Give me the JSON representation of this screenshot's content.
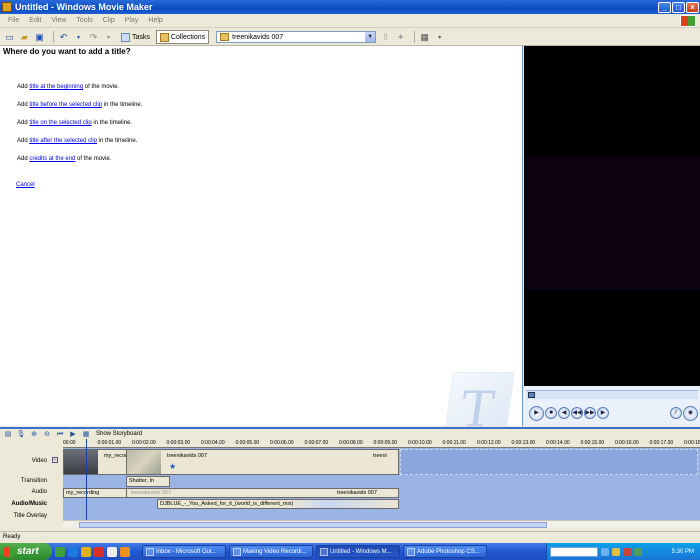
{
  "window": {
    "title": "Untitled - Windows Movie Maker"
  },
  "menu": [
    "File",
    "Edit",
    "View",
    "Tools",
    "Clip",
    "Play",
    "Help"
  ],
  "toolbar": {
    "tasks_label": "Tasks",
    "collections_label": "Collections",
    "collection_value": "treenikavids 007"
  },
  "taskpane": {
    "heading": "Where do you want to add a title?",
    "options": [
      {
        "prefix": "Add ",
        "link": "title at the beginning",
        "suffix": " of the movie."
      },
      {
        "prefix": "Add ",
        "link": "title before the selected clip",
        "suffix": " in the timeline."
      },
      {
        "prefix": "Add ",
        "link": "title on the selected clip",
        "suffix": " in the timeline."
      },
      {
        "prefix": "Add ",
        "link": "title after the selected clip",
        "suffix": " in the timeline."
      },
      {
        "prefix": "Add ",
        "link": "credits at the end",
        "suffix": " of the movie."
      }
    ],
    "cancel": "Cancel",
    "watermark_letter": "T"
  },
  "timeline": {
    "toolbar_label": "Show Storyboard",
    "ruler": [
      "00:00",
      "0:00:01.00",
      "0:00:02.00",
      "0:00:03.00",
      "0:00:04.00",
      "0:00:05.00",
      "0:00:06.00",
      "0:00:07.00",
      "0:00:08.00",
      "0:00:09.00",
      "0:00:10.00",
      "0:00:11.00",
      "0:00:12.00",
      "0:00:13.00",
      "0:00:14.00",
      "0:00:15.00",
      "0:00:16.00",
      "0:00:17.00",
      "0:00:18"
    ],
    "track_names": [
      "Video",
      "Transition",
      "Audio",
      "Audio/Music",
      "Title Overlay"
    ],
    "video_expand": "−",
    "video_clips": [
      "my_recording",
      "treenikavids 007",
      "treeni"
    ],
    "transition_clip": "Shatter, In",
    "audio_clips": [
      "my_recording",
      "treenikavids 007",
      "treenikavids 007"
    ],
    "music_clip": "DJBLUE_-_You_Asked_for_it_(world_is_different_mix)"
  },
  "status": {
    "text": "Ready"
  },
  "taskbar": {
    "start": "start",
    "tasks": [
      "Inbox - Microsoft Out...",
      "Making Video Recordi...",
      "Untitled - Windows M...",
      "Adobe Photoshop CS..."
    ],
    "clock": "5:30 PM"
  },
  "colors": {
    "titlebar": "#0a4bc0",
    "timeline_bg": "#9ab4e6",
    "link": "#0000ee",
    "taskbar": "#2457d0",
    "start": "#2b8a2b"
  }
}
